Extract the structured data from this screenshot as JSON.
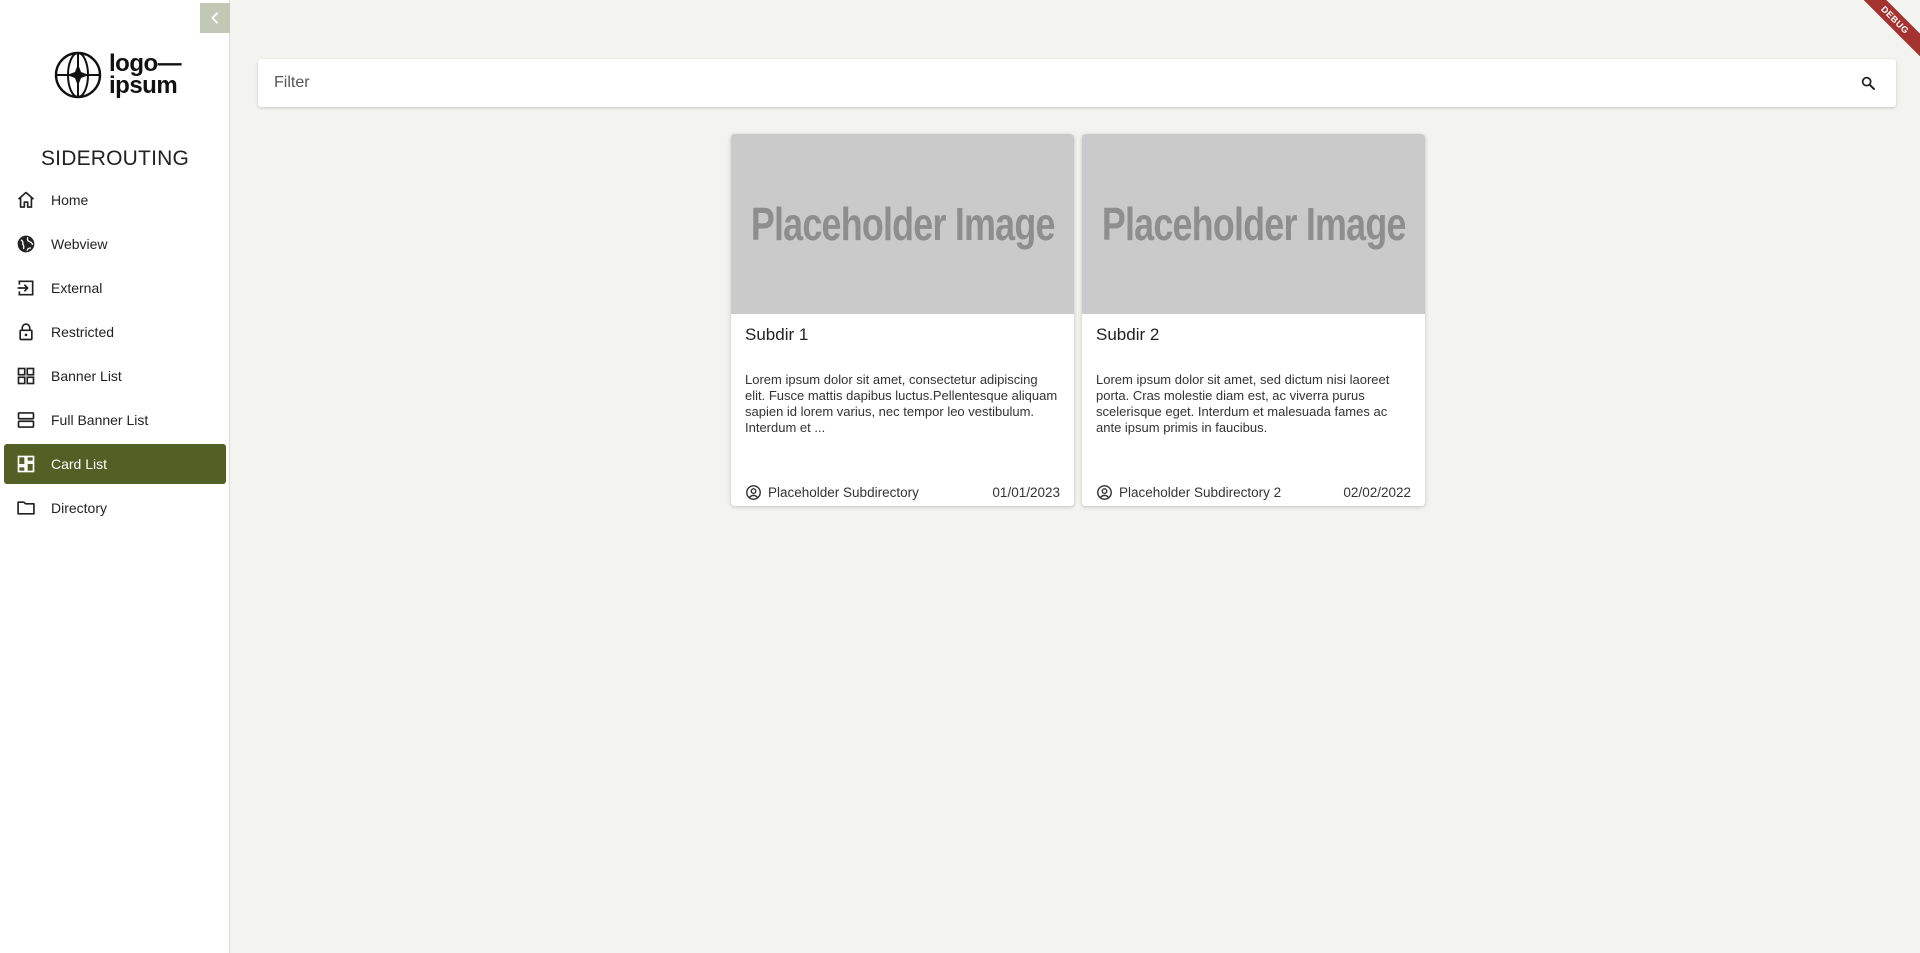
{
  "sidebar": {
    "logo_line1": "logo—",
    "logo_line2": "ipsum",
    "title": "SIDEROUTING",
    "collapse_icon": "chevron-left-icon",
    "items": [
      {
        "label": "Home",
        "icon": "home-icon",
        "active": false
      },
      {
        "label": "Webview",
        "icon": "globe-icon",
        "active": false
      },
      {
        "label": "External",
        "icon": "login-icon",
        "active": false
      },
      {
        "label": "Restricted",
        "icon": "lock-icon",
        "active": false
      },
      {
        "label": "Banner List",
        "icon": "grid-icon",
        "active": false
      },
      {
        "label": "Full Banner List",
        "icon": "stacked-rows-icon",
        "active": false
      },
      {
        "label": "Card List",
        "icon": "dashboard-icon",
        "active": true
      },
      {
        "label": "Directory",
        "icon": "folder-icon",
        "active": false
      }
    ]
  },
  "filter": {
    "placeholder": "Filter",
    "value": "",
    "icon": "search-icon"
  },
  "cards": [
    {
      "image_text": "Placeholder Image",
      "title": "Subdir 1",
      "description": "Lorem ipsum dolor sit amet, consectetur adipiscing elit. Fusce mattis dapibus luctus.Pellentesque aliquam sapien id lorem varius, nec tempor leo vestibulum. Interdum et ...",
      "author": "Placeholder Subdirectory",
      "date": "01/01/2023"
    },
    {
      "image_text": "Placeholder Image",
      "title": "Subdir 2",
      "description": "Lorem ipsum dolor sit amet, sed dictum nisi laoreet porta. Cras molestie diam est, ac viverra purus scelerisque eget. Interdum et malesuada fames ac ante ipsum primis in faucibus.",
      "author": "Placeholder Subdirectory 2",
      "date": "02/02/2022"
    }
  ],
  "debug_banner": "DEBUG",
  "colors": {
    "accent": "#545f25",
    "background": "#f3f3ef",
    "collapse_button": "#c3c7b6",
    "placeholder_image": "#cacaca",
    "debug_ribbon": "#a4322f"
  }
}
